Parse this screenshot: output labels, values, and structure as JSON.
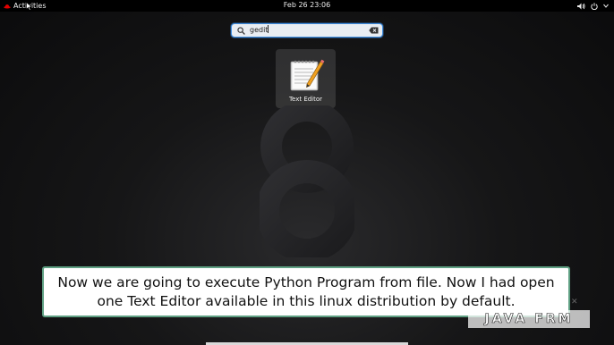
{
  "topbar": {
    "activities_label": "Activities",
    "clock": "Feb 26  23:06",
    "tray_icons": [
      "volume-icon",
      "power-icon",
      "chevron-down-icon"
    ]
  },
  "search": {
    "value": "gedit",
    "icon": "search-icon",
    "clear_icon": "backspace-clear-icon"
  },
  "results": [
    {
      "label": "Text Editor",
      "icon": "text-editor-icon"
    }
  ],
  "wallpaper": {
    "glyph": "8"
  },
  "caption": {
    "text": "Now we are going to execute Python Program from file. Now I had open one Text Editor available in this linux distribution by default."
  },
  "watermark": {
    "text": "JAVA FRM"
  },
  "colors": {
    "topbar_bg": "#000000",
    "search_border": "#3e8de0",
    "caption_border": "#5fa083",
    "redhat_red": "#e00000"
  }
}
